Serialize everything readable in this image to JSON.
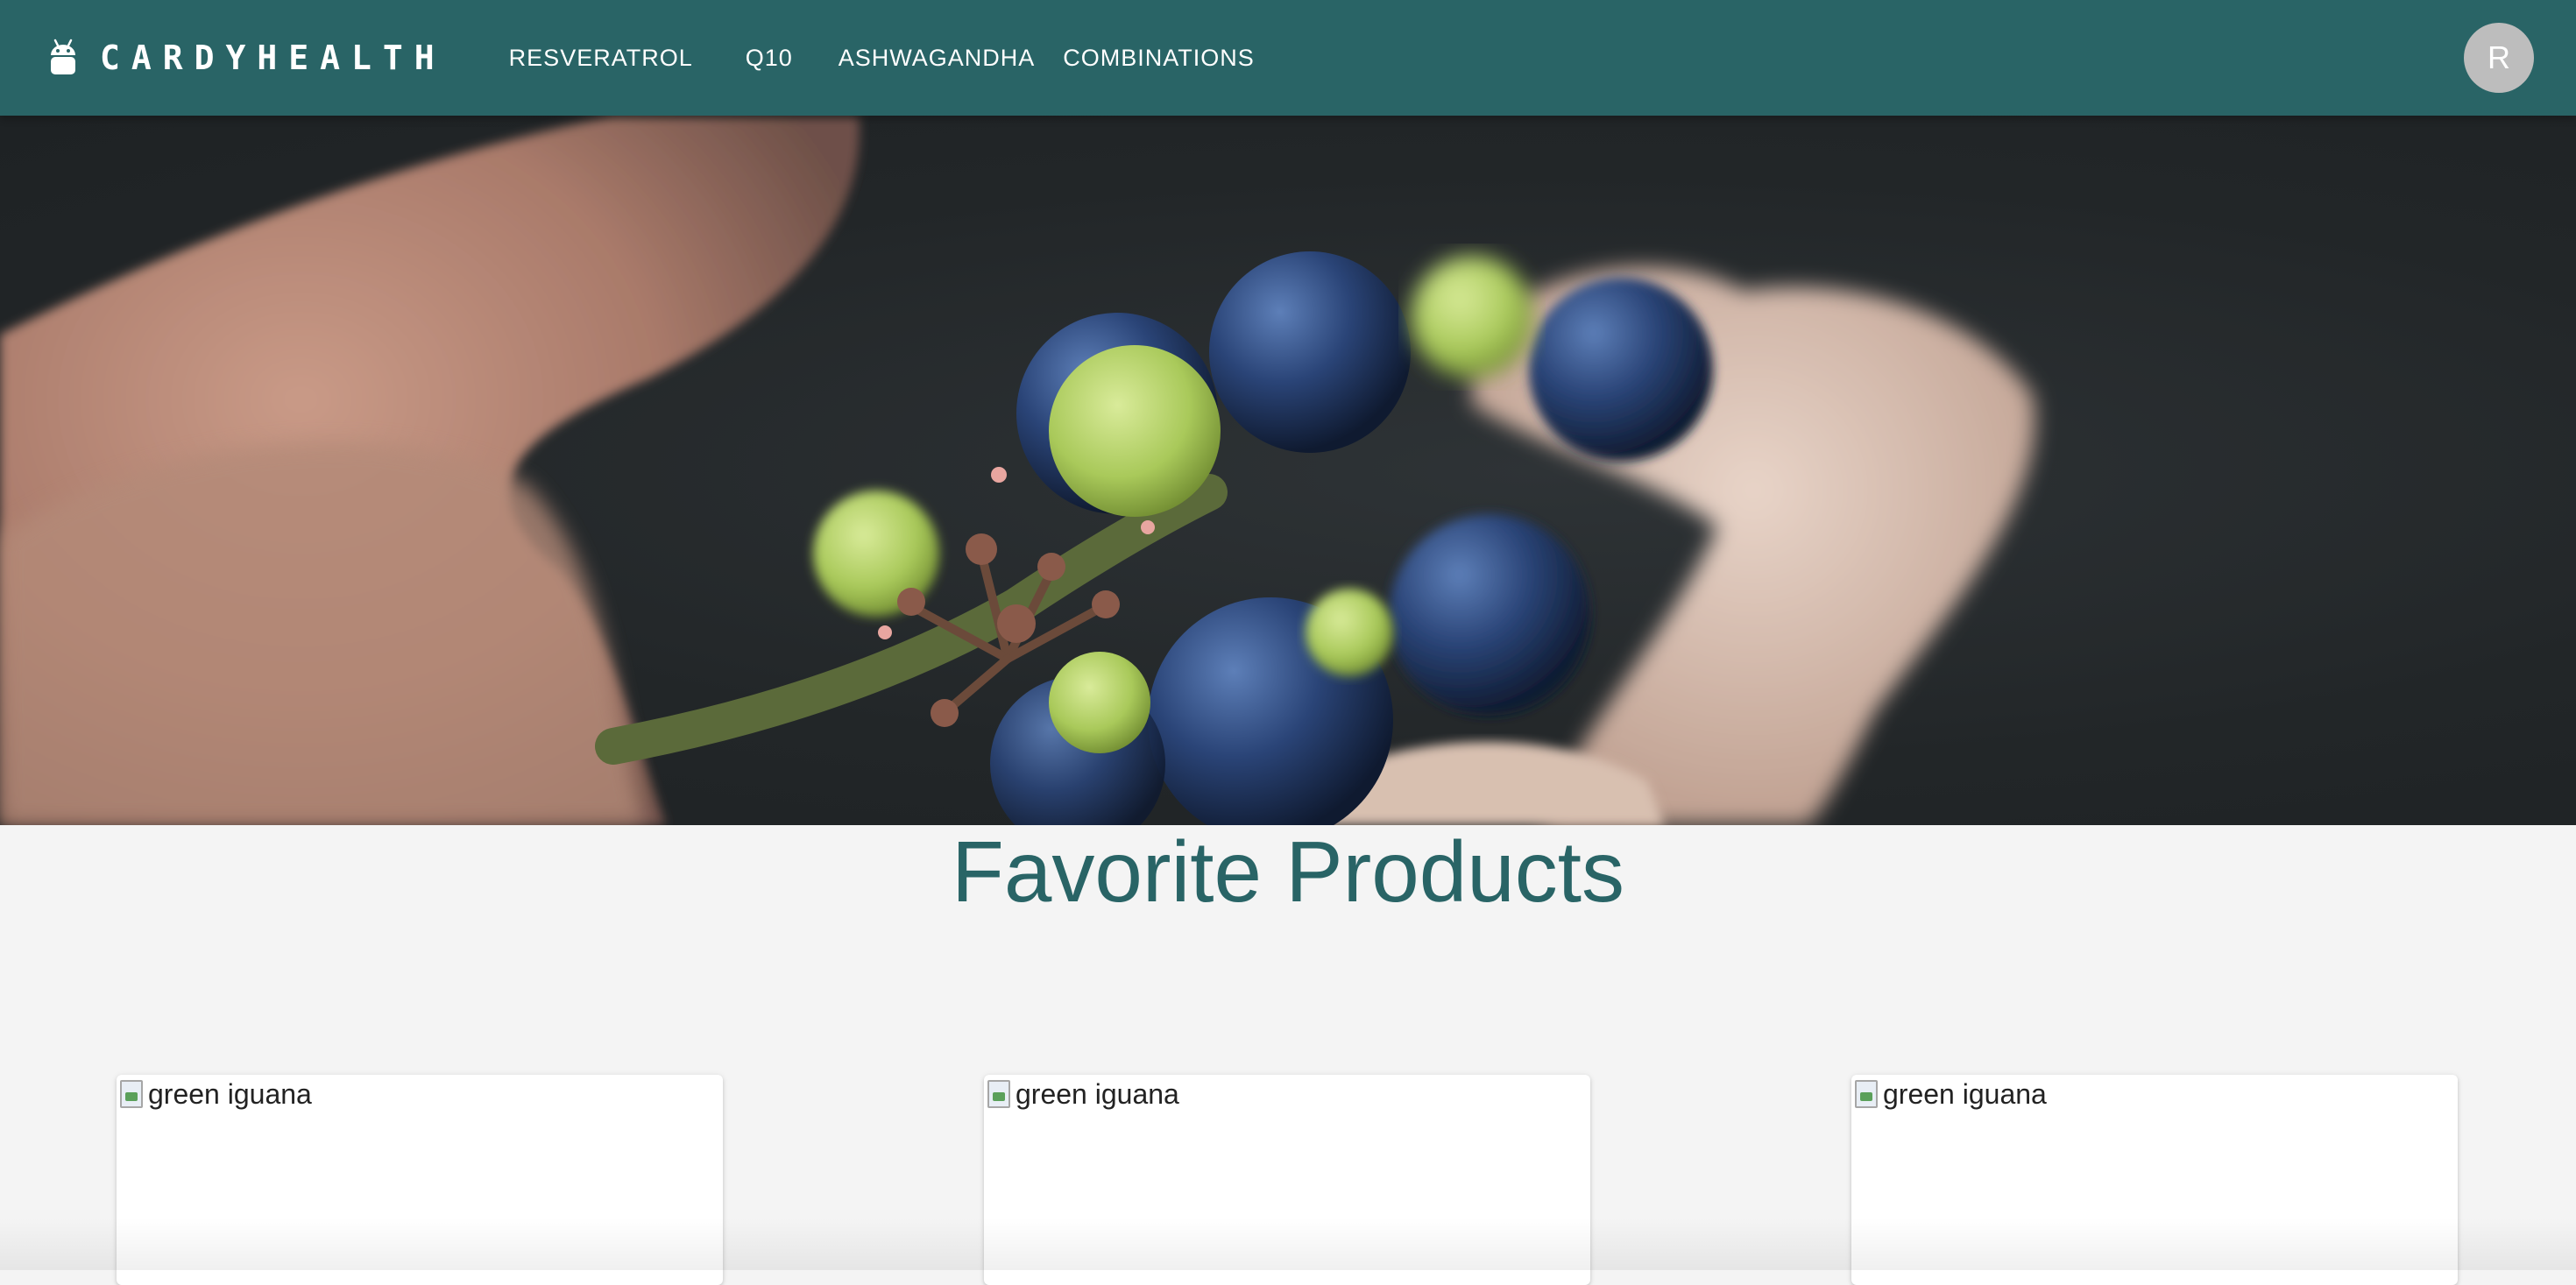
{
  "header": {
    "brand": "CARDYHEALTH",
    "nav": [
      "RESVERATROL",
      "Q10",
      "ASHWAGANDHA",
      "COMBINATIONS"
    ],
    "avatar_initial": "R"
  },
  "hero": {
    "alt": "hand holding grapes"
  },
  "main": {
    "title": "Favorite Products",
    "cards": [
      {
        "image_alt": "green iguana"
      },
      {
        "image_alt": "green iguana"
      },
      {
        "image_alt": "green iguana"
      }
    ]
  },
  "colors": {
    "primary": "#296466",
    "background": "#f4f4f4",
    "avatar": "#bdbdbd"
  },
  "icons": {
    "brand": "android-icon",
    "card_image": "broken-image-icon"
  }
}
